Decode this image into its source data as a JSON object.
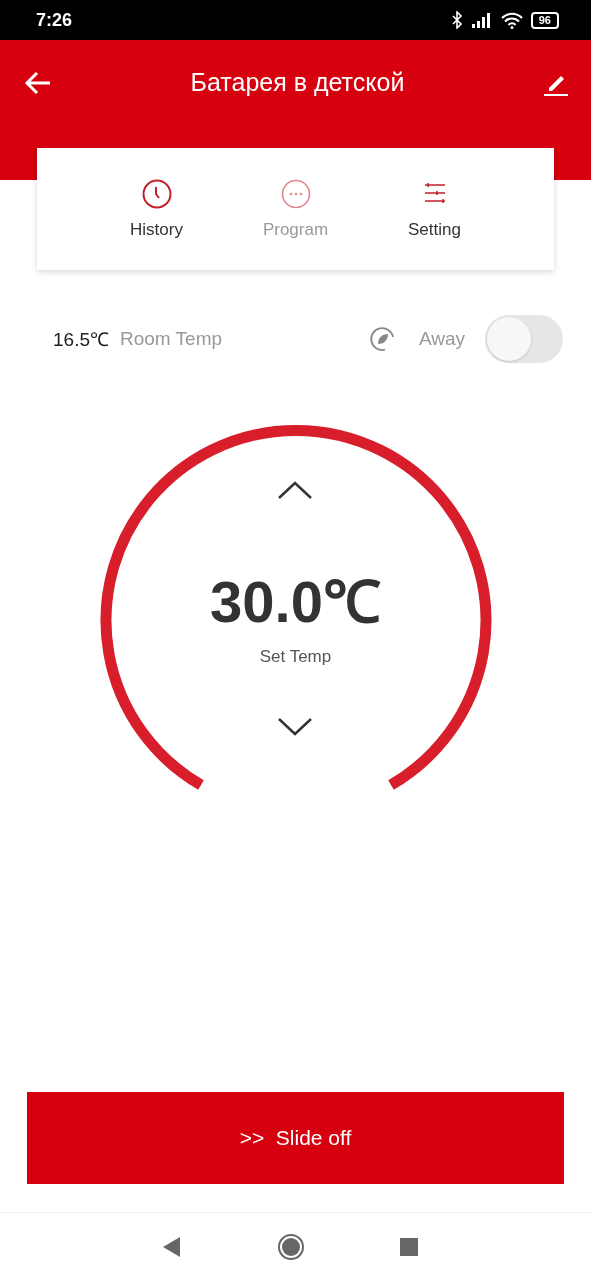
{
  "status_bar": {
    "time": "7:26",
    "battery": "96"
  },
  "header": {
    "title": "Батарея в детской"
  },
  "tabs": [
    {
      "label": "History",
      "kind": "clock",
      "disabled": false
    },
    {
      "label": "Program",
      "kind": "dots",
      "disabled": true
    },
    {
      "label": "Setting",
      "kind": "sliders",
      "disabled": false
    }
  ],
  "room": {
    "temp": "16.5℃",
    "label": "Room Temp"
  },
  "away": {
    "label": "Away",
    "on": false
  },
  "dial": {
    "value": "30.0℃",
    "label": "Set Temp"
  },
  "slide_button": {
    "arrows": ">>",
    "label": "Slide off"
  }
}
